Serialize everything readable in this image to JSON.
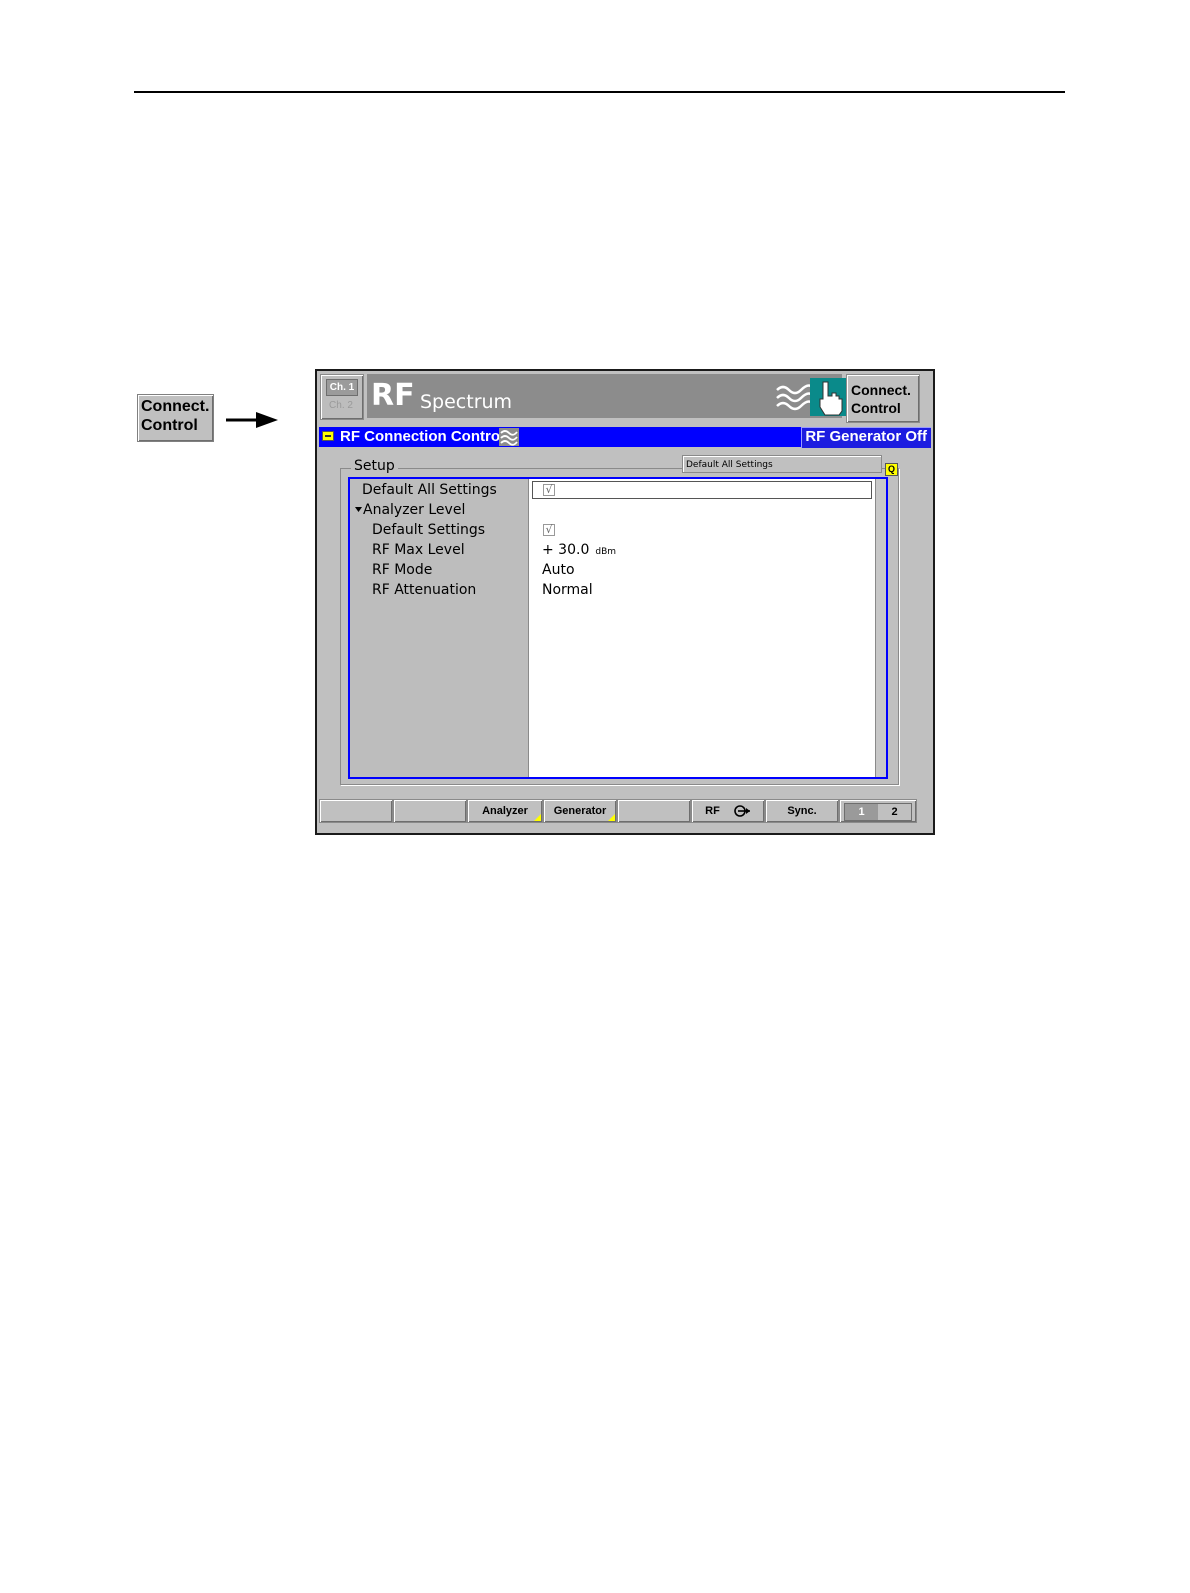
{
  "side_button": {
    "line1": "Connect.",
    "line2": "Control"
  },
  "header": {
    "ch1": "Ch. 1",
    "ch2": "Ch. 2",
    "title_main": "RF",
    "title_sub": "Spectrum",
    "connect_line1": "Connect.",
    "connect_line2": "Control"
  },
  "menu_bar": {
    "title": "RF Connection Control",
    "status": "RF Generator Off"
  },
  "setup": {
    "group_label": "Setup",
    "default_button": "Default All Settings",
    "quick_icon": "Q",
    "tree": [
      {
        "label": "Default All Settings"
      },
      {
        "label": "Analyzer Level",
        "expanded": true
      },
      {
        "label": "Default Settings"
      },
      {
        "label": "RF Max Level"
      },
      {
        "label": "RF Mode"
      },
      {
        "label": "RF Attenuation"
      }
    ],
    "values": {
      "default_all": "√",
      "default_settings": "√",
      "rf_max_level": "+ 30.0",
      "rf_max_level_unit": "dBm",
      "rf_mode": "Auto",
      "rf_attenuation": "Normal"
    }
  },
  "softkeys": {
    "analyzer": "Analyzer",
    "generator": "Generator",
    "rf": "RF",
    "sync": "Sync.",
    "page1": "1",
    "page2": "2"
  },
  "colors": {
    "accent_blue": "#0000ff",
    "indicator_yellow": "#ffff00",
    "icon_teal": "#0a8a8a"
  }
}
